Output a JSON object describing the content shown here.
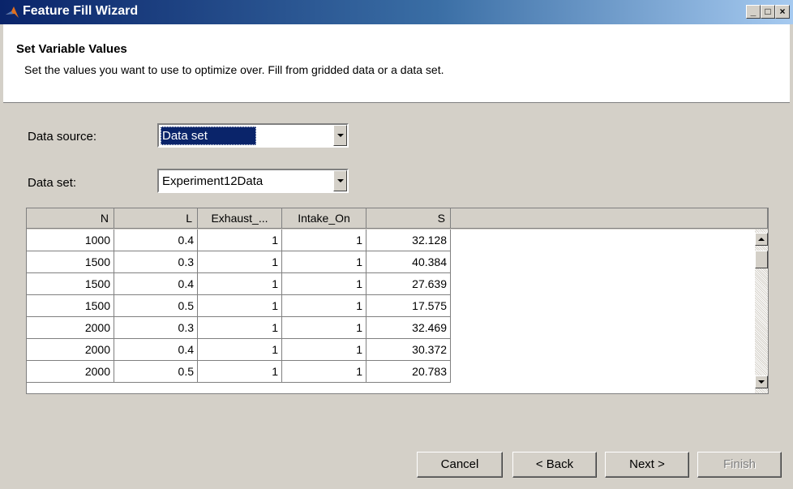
{
  "window": {
    "title": "Feature Fill Wizard"
  },
  "header": {
    "title": "Set Variable Values",
    "description": "Set the values you want to use to optimize over. Fill from gridded data or a data set."
  },
  "data_source": {
    "label": "Data source:",
    "value": "Data set"
  },
  "data_set": {
    "label": "Data set:",
    "value": "Experiment12Data"
  },
  "table": {
    "columns": [
      "N",
      "L",
      "Exhaust_...",
      "Intake_On",
      "S"
    ],
    "rows": [
      [
        "1000",
        "0.4",
        "1",
        "1",
        "32.128"
      ],
      [
        "1500",
        "0.3",
        "1",
        "1",
        "40.384"
      ],
      [
        "1500",
        "0.4",
        "1",
        "1",
        "27.639"
      ],
      [
        "1500",
        "0.5",
        "1",
        "1",
        "17.575"
      ],
      [
        "2000",
        "0.3",
        "1",
        "1",
        "32.469"
      ],
      [
        "2000",
        "0.4",
        "1",
        "1",
        "30.372"
      ],
      [
        "2000",
        "0.5",
        "1",
        "1",
        "20.783"
      ]
    ]
  },
  "buttons": {
    "cancel": "Cancel",
    "back": "< Back",
    "next": "Next >",
    "finish": "Finish"
  },
  "colors": {
    "title_bar": "#0a246a",
    "selection": "#0a246a",
    "face": "#d4d0c8"
  }
}
